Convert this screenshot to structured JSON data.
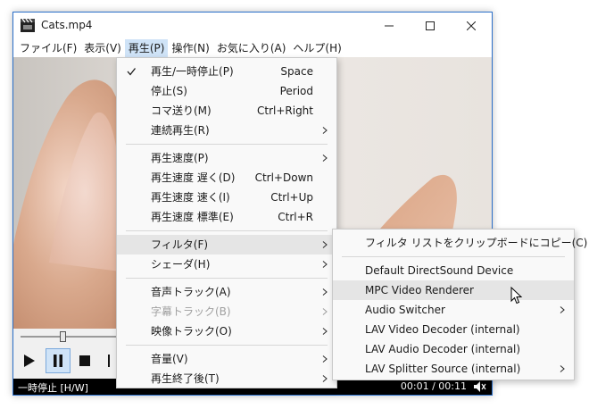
{
  "window": {
    "title": "Cats.mp4"
  },
  "menubar": [
    {
      "label": "ファイル(F)"
    },
    {
      "label": "表示(V)"
    },
    {
      "label": "再生(P)"
    },
    {
      "label": "操作(N)"
    },
    {
      "label": "お気に入り(A)"
    },
    {
      "label": "ヘルプ(H)"
    }
  ],
  "play_menu": {
    "items": [
      {
        "label": "再生/一時停止(P)",
        "shortcut": "Space",
        "checked": true
      },
      {
        "label": "停止(S)",
        "shortcut": "Period"
      },
      {
        "label": "コマ送り(M)",
        "shortcut": "Ctrl+Right"
      },
      {
        "label": "連続再生(R)",
        "submenu": true
      },
      {
        "label": "再生速度(P)",
        "submenu": true
      },
      {
        "label": "再生速度 遅く(D)",
        "shortcut": "Ctrl+Down"
      },
      {
        "label": "再生速度 速く(I)",
        "shortcut": "Ctrl+Up"
      },
      {
        "label": "再生速度 標準(E)",
        "shortcut": "Ctrl+R"
      },
      {
        "label": "フィルタ(F)",
        "submenu": true,
        "highlighted": true
      },
      {
        "label": "シェーダ(H)",
        "submenu": true
      },
      {
        "label": "音声トラック(A)",
        "submenu": true
      },
      {
        "label": "字幕トラック(B)",
        "submenu": true,
        "disabled": true
      },
      {
        "label": "映像トラック(O)",
        "submenu": true
      },
      {
        "label": "音量(V)",
        "submenu": true
      },
      {
        "label": "再生終了後(T)",
        "submenu": true
      }
    ]
  },
  "filter_submenu": {
    "items": [
      {
        "label": "フィルタ リストをクリップボードにコピー(C)"
      },
      {
        "label": "Default DirectSound Device"
      },
      {
        "label": "MPC Video Renderer",
        "highlighted": true
      },
      {
        "label": "Audio Switcher",
        "submenu": true
      },
      {
        "label": "LAV Video Decoder (internal)"
      },
      {
        "label": "LAV Audio Decoder (internal)"
      },
      {
        "label": "LAV Splitter Source (internal)",
        "submenu": true
      }
    ]
  },
  "status": {
    "left": "一時停止 [H/W]",
    "time": "00:01 / 00:11"
  },
  "seek": {
    "position_fraction": 0.09
  },
  "colors": {
    "accent": "#2b6fc9",
    "menu_highlight": "#e5e5e5",
    "active_control": "#cfe3f7"
  }
}
